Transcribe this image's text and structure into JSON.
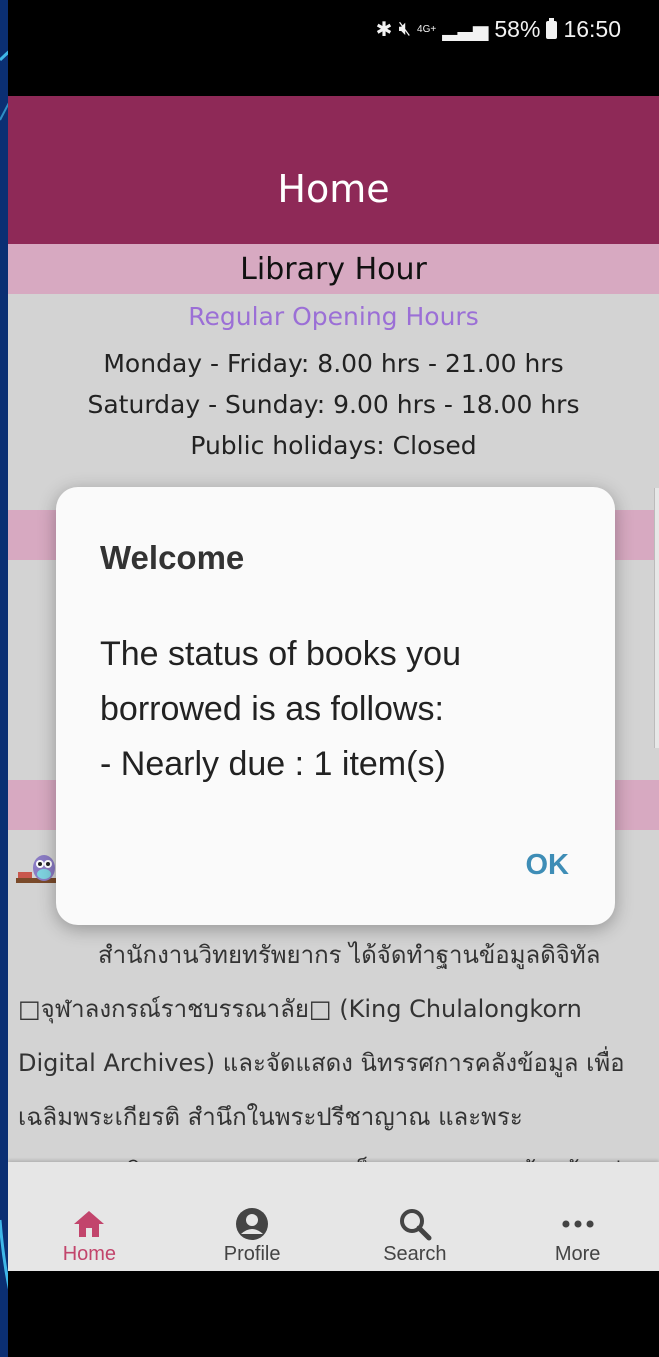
{
  "status_bar": {
    "network": "4G+",
    "battery": "58%",
    "time": "16:50"
  },
  "header": {
    "title": "Home"
  },
  "library_hour": {
    "heading": "Library Hour",
    "subheading": "Regular Opening Hours",
    "lines": [
      "Monday - Friday: 8.00 hrs - 21.00 hrs",
      "Saturday - Sunday: 9.00 hrs - 18.00 hrs",
      "Public holidays: Closed"
    ]
  },
  "news_text": "สำนักงานวิทยทรัพยากร ได้จัดทำฐานข้อมูลดิจิทัล □จุฬาลงกรณ์ราชบรรณาลัย□ (King Chulalongkorn Digital Archives) และจัดแสดง นิทรรศการคลังข้อมูล เพื่อเฉลิมพระเกียรติ สำนึกในพระปรีชาญาณ และพระมหากรุณาธิคุณของพระบาท สมเด็จพระจุลจอมเกล้า เจ้าอยู่",
  "dialog": {
    "title": "Welcome",
    "body_lines": [
      "The status of books you",
      "borrowed is as follows:",
      "- Nearly due : 1 item(s)"
    ],
    "ok_label": "OK"
  },
  "bottom_nav": [
    {
      "label": "Home",
      "icon": "home-icon",
      "active": true
    },
    {
      "label": "Profile",
      "icon": "profile-icon",
      "active": false
    },
    {
      "label": "Search",
      "icon": "search-icon",
      "active": false
    },
    {
      "label": "More",
      "icon": "more-icon",
      "active": false
    }
  ],
  "colors": {
    "header": "#8e2957",
    "section_band": "#d7a9c1",
    "subheading": "#9b6fd6",
    "active_nav": "#c2456c",
    "dialog_button": "#3e8db6"
  }
}
